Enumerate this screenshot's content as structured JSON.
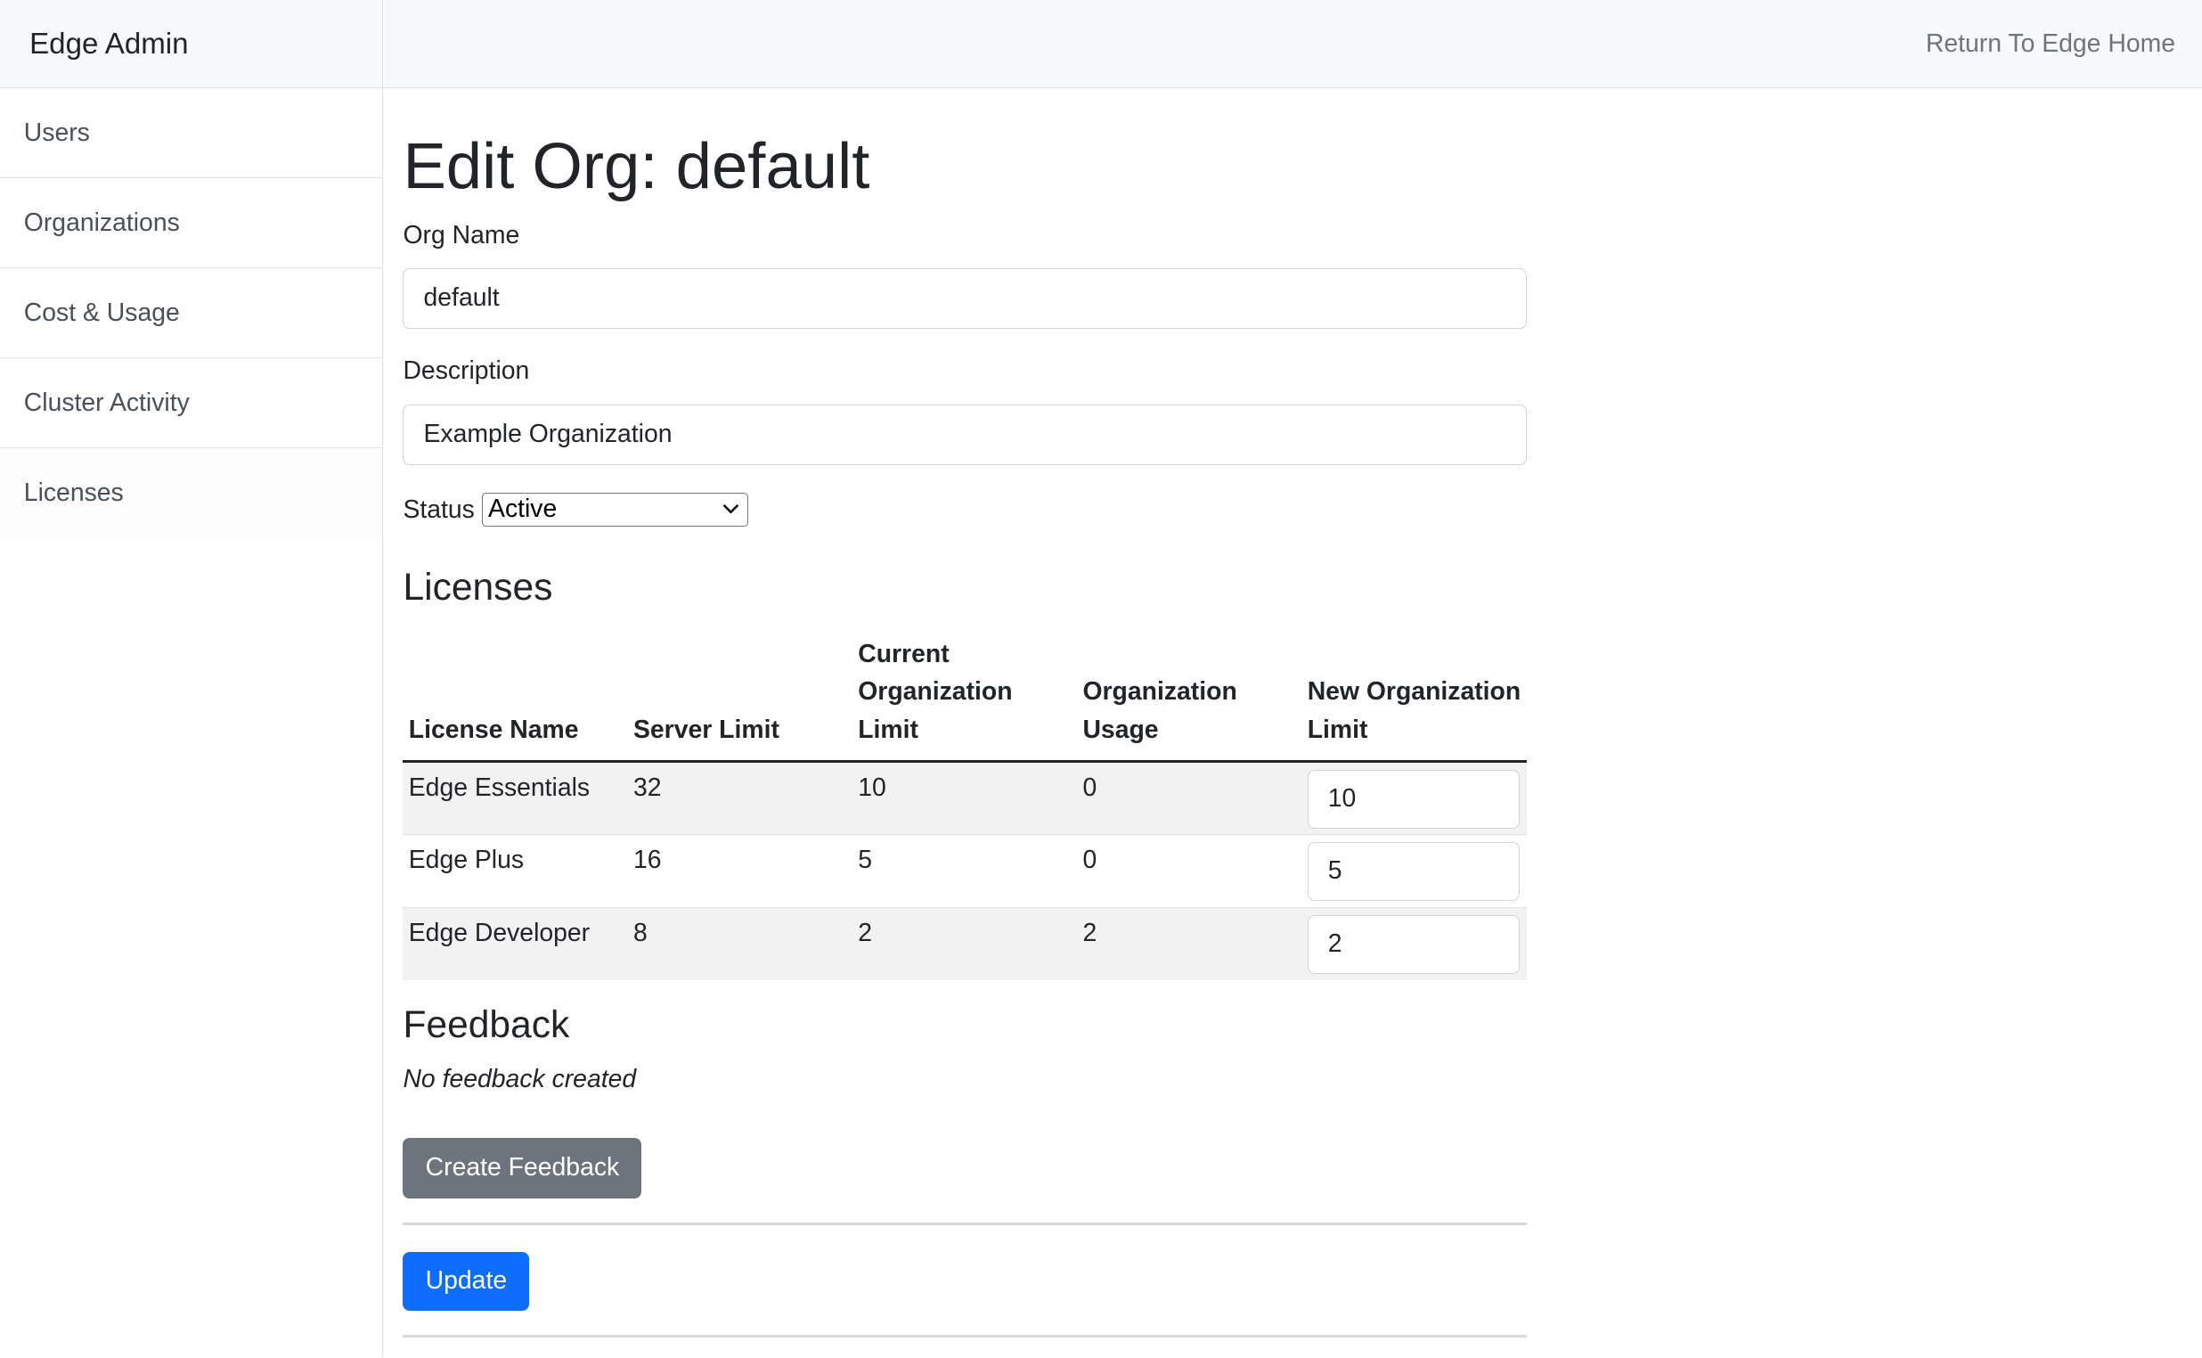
{
  "header": {
    "brand": "Edge Admin",
    "return_link": "Return To Edge Home"
  },
  "sidebar": {
    "items": [
      {
        "label": "Users"
      },
      {
        "label": "Organizations"
      },
      {
        "label": "Cost & Usage"
      },
      {
        "label": "Cluster Activity"
      },
      {
        "label": "Licenses"
      }
    ]
  },
  "page": {
    "title": "Edit Org: default"
  },
  "form": {
    "org_name_label": "Org Name",
    "org_name_value": "default",
    "description_label": "Description",
    "description_value": "Example Organization",
    "status_label": "Status",
    "status_value": "Active"
  },
  "licenses": {
    "heading": "Licenses",
    "columns": [
      "License Name",
      "Server Limit",
      "Current Organization Limit",
      "Organization Usage",
      "New Organization Limit"
    ],
    "rows": [
      {
        "name": "Edge Essentials",
        "server_limit": "32",
        "current_limit": "10",
        "usage": "0",
        "new_limit": "10"
      },
      {
        "name": "Edge Plus",
        "server_limit": "16",
        "current_limit": "5",
        "usage": "0",
        "new_limit": "5"
      },
      {
        "name": "Edge Developer",
        "server_limit": "8",
        "current_limit": "2",
        "usage": "2",
        "new_limit": "2"
      }
    ]
  },
  "feedback": {
    "heading": "Feedback",
    "empty_text": "No feedback created",
    "create_button": "Create Feedback"
  },
  "actions": {
    "update_button": "Update"
  },
  "colors": {
    "primary": "#0d6efd",
    "secondary": "#6c757d",
    "header_bg": "#f8f9fa",
    "border": "#dee2e6"
  }
}
